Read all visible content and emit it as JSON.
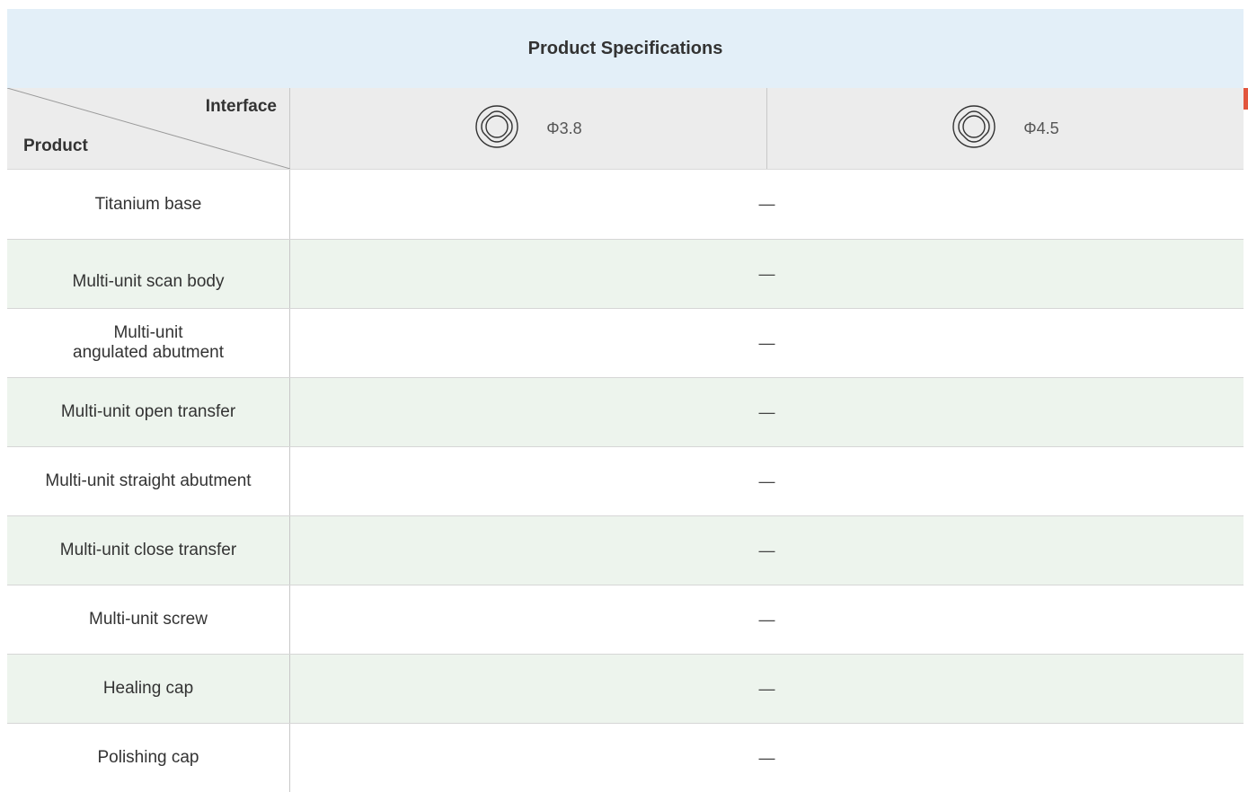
{
  "table": {
    "title": "Product Specifications",
    "corner": {
      "interface_label": "Interface",
      "product_label": "Product"
    },
    "interfaces": [
      {
        "label": "Φ3.8",
        "icon": "implant-connection-icon"
      },
      {
        "label": "Φ4.5",
        "icon": "implant-connection-icon"
      }
    ],
    "rows": [
      {
        "name": "Titanium base",
        "value": "—"
      },
      {
        "name": "Multi-unit scan body",
        "value": "—"
      },
      {
        "name": "Multi-unit\nangulated abutment",
        "value": "—"
      },
      {
        "name": "Multi-unit open transfer",
        "value": "—"
      },
      {
        "name": "Multi-unit straight abutment",
        "value": "—"
      },
      {
        "name": "Multi-unit close transfer",
        "value": "—"
      },
      {
        "name": "Multi-unit screw",
        "value": "—"
      },
      {
        "name": "Healing cap",
        "value": "—"
      },
      {
        "name": "Polishing cap",
        "value": "—"
      }
    ]
  },
  "colors": {
    "title_bg": "#e3eff8",
    "header_bg": "#ececec",
    "alt_row_bg": "#edf4ed",
    "accent": "#e2553d"
  }
}
